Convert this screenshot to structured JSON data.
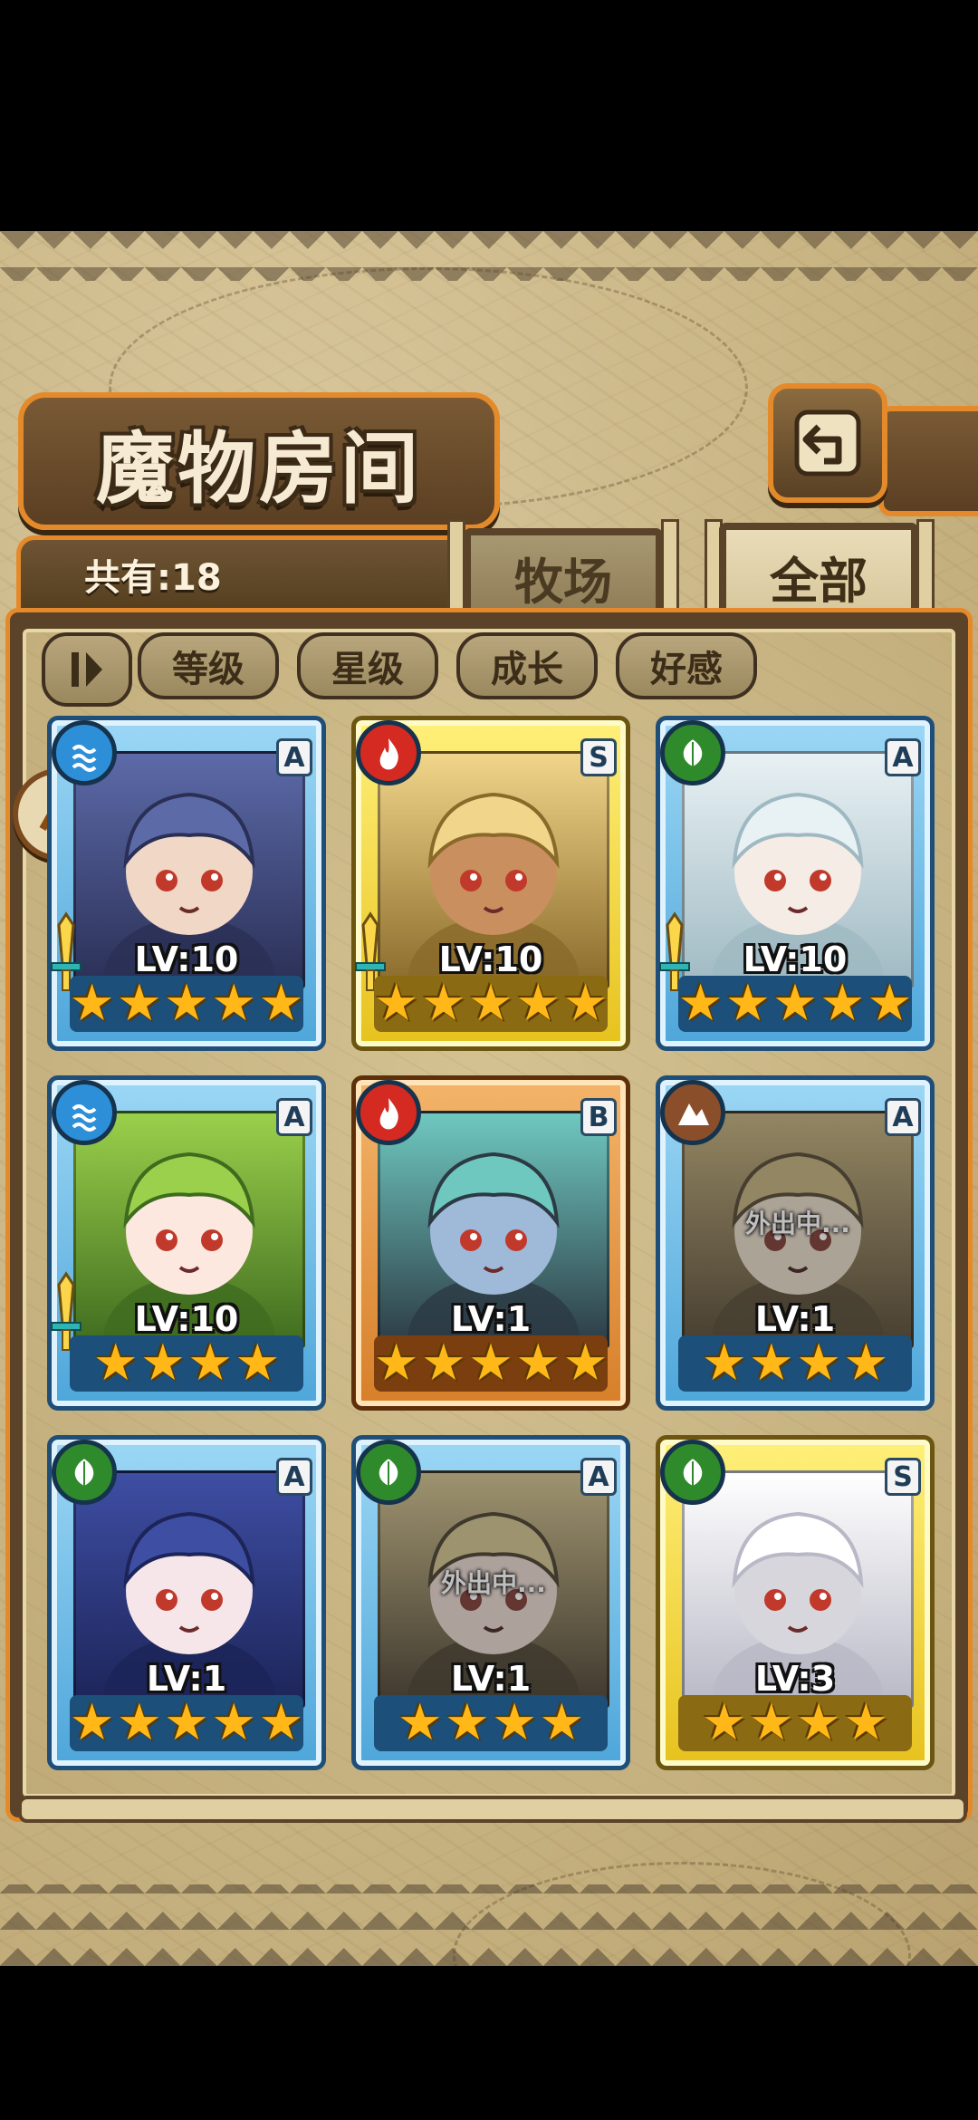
{
  "header": {
    "title": "魔物房间",
    "back_icon": "return-arrow-icon"
  },
  "tabs": {
    "count_text": "共有:18",
    "ranch_label": "牧场",
    "all_label": "全部",
    "active": "全部"
  },
  "filters": {
    "toggle_icon": "sort-toggle-icon",
    "buttons": [
      "等级",
      "星级",
      "成长",
      "好感"
    ]
  },
  "monsters": [
    {
      "element": "water",
      "rank": "A",
      "level": "LV:10",
      "stars": 5,
      "equipped": true,
      "away": false,
      "frame": "A"
    },
    {
      "element": "fire",
      "rank": "S",
      "level": "LV:10",
      "stars": 5,
      "equipped": true,
      "away": false,
      "frame": "S"
    },
    {
      "element": "grass",
      "rank": "A",
      "level": "LV:10",
      "stars": 5,
      "equipped": true,
      "away": false,
      "frame": "A"
    },
    {
      "element": "water",
      "rank": "A",
      "level": "LV:10",
      "stars": 4,
      "equipped": true,
      "away": false,
      "frame": "A"
    },
    {
      "element": "fire",
      "rank": "B",
      "level": "LV:1",
      "stars": 5,
      "equipped": false,
      "away": false,
      "frame": "B"
    },
    {
      "element": "earth",
      "rank": "A",
      "level": "LV:1",
      "stars": 4,
      "equipped": false,
      "away": true,
      "away_text": "外出中...",
      "frame": "A"
    },
    {
      "element": "grass",
      "rank": "A",
      "level": "LV:1",
      "stars": 5,
      "equipped": false,
      "away": false,
      "frame": "A"
    },
    {
      "element": "grass",
      "rank": "A",
      "level": "LV:1",
      "stars": 4,
      "equipped": false,
      "away": true,
      "away_text": "外出中...",
      "frame": "A"
    },
    {
      "element": "grass",
      "rank": "S",
      "level": "LV:3",
      "stars": 4,
      "equipped": false,
      "away": false,
      "frame": "S"
    }
  ],
  "colors": {
    "accent_orange": "#e58a2b",
    "water": "#2d8fd8",
    "fire": "#d42a22",
    "grass": "#2f8a2b",
    "earth": "#8a4f2a",
    "star": "#ffb818"
  }
}
